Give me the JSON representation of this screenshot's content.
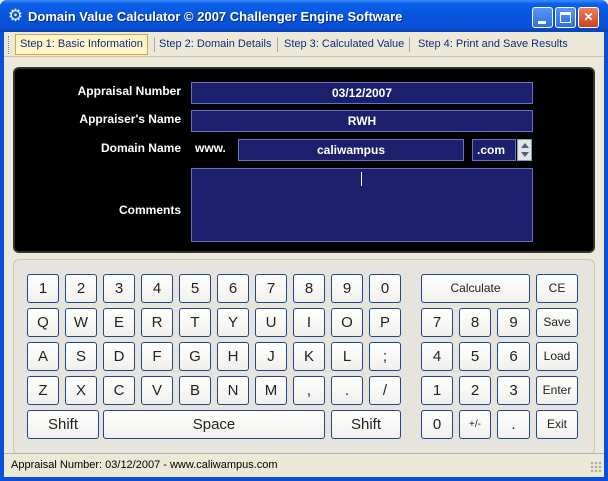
{
  "window": {
    "title": "Domain Value Calculator © 2007 Challenger Engine Software",
    "icon": "gear-icon"
  },
  "tabs": [
    {
      "label": "Step 1: Basic Information",
      "active": true
    },
    {
      "label": "Step 2: Domain Details",
      "active": false
    },
    {
      "label": "Step 3: Calculated Value",
      "active": false
    },
    {
      "label": "Step 4: Print and Save Results",
      "active": false
    }
  ],
  "form": {
    "appraisal_number_label": "Appraisal Number",
    "appraisal_number_value": "03/12/2007",
    "appraiser_name_label": "Appraiser's Name",
    "appraiser_name_value": "RWH",
    "domain_name_label": "Domain Name",
    "domain_prefix": "www.",
    "domain_name_value": "caliwampus",
    "tld_value": ".com",
    "comments_label": "Comments",
    "comments_value": ""
  },
  "keyboard": {
    "row1": [
      "1",
      "2",
      "3",
      "4",
      "5",
      "6",
      "7",
      "8",
      "9",
      "0"
    ],
    "row2": [
      "Q",
      "W",
      "E",
      "R",
      "T",
      "Y",
      "U",
      "I",
      "O",
      "P"
    ],
    "row3": [
      "A",
      "S",
      "D",
      "F",
      "G",
      "H",
      "J",
      "K",
      "L",
      ";"
    ],
    "row4": [
      "Z",
      "X",
      "C",
      "V",
      "B",
      "N",
      "M",
      ",",
      ".",
      "/"
    ],
    "shift_left": "Shift",
    "space": "Space",
    "shift_right": "Shift",
    "numpad": {
      "calculate": "Calculate",
      "ce": "CE",
      "row1": [
        "7",
        "8",
        "9"
      ],
      "save": "Save",
      "row2": [
        "4",
        "5",
        "6"
      ],
      "load": "Load",
      "row3": [
        "1",
        "2",
        "3"
      ],
      "enter": "Enter",
      "zero": "0",
      "plusminus": "+/-",
      "dot": ".",
      "exit": "Exit"
    }
  },
  "status": {
    "text": "Appraisal Number: 03/12/2007 - www.caliwampus.com"
  },
  "colors": {
    "title_bar": "#0650d6",
    "panel_bg": "#000000",
    "field_bg": "#1c1f6b",
    "active_tab_bg": "#fff5c8"
  }
}
